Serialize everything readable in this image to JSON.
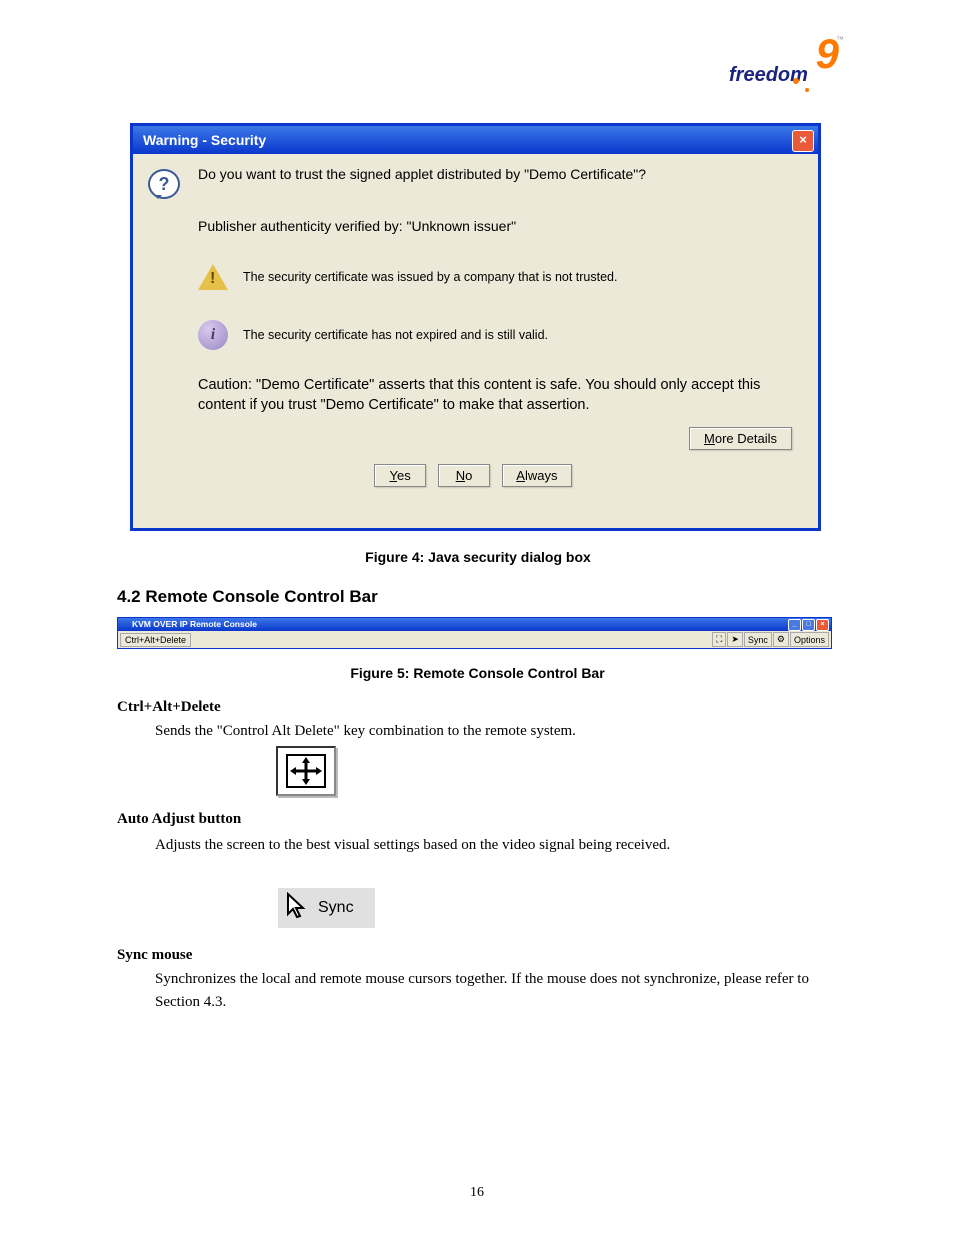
{
  "logo": {
    "text": "freedom",
    "accent": "9",
    "tm": "™"
  },
  "dialog": {
    "title": "Warning - Security",
    "question": "Do you want to trust the signed applet distributed by \"Demo Certificate\"?",
    "publisher": "Publisher authenticity verified by: \"Unknown issuer\"",
    "cert_untrusted": "The security certificate was issued by a company that is not trusted.",
    "cert_valid": "The security certificate has not expired and is still valid.",
    "caution": "Caution: \"Demo Certificate\" asserts that this content is safe. You should only accept this content if you trust \"Demo Certificate\" to make that assertion.",
    "more_details": "More Details",
    "yes": "Yes",
    "no": "No",
    "always": "Always"
  },
  "fig4": "Figure 4: Java security dialog box",
  "section_control": "4.2  Remote Console Control Bar",
  "kvm": {
    "title": "KVM OVER IP Remote Console",
    "cad": "Ctrl+Alt+Delete",
    "sync": "Sync",
    "options": "Options"
  },
  "fig5": "Figure 5: Remote Console Control Bar",
  "cad_label": "Ctrl+Alt+Delete",
  "cad_desc": "Sends the \"Control Alt Delete\" key combination to the remote system.",
  "auto_label": "Auto Adjust button",
  "auto_desc": "Adjusts the screen to the best visual settings based on the video signal being received.",
  "sync_label": "Sync mouse",
  "sync_desc": "Synchronizes the local and remote mouse cursors together. If the mouse does not synchronize, please refer to Section 4.3.",
  "info_i": "i",
  "page": "16"
}
